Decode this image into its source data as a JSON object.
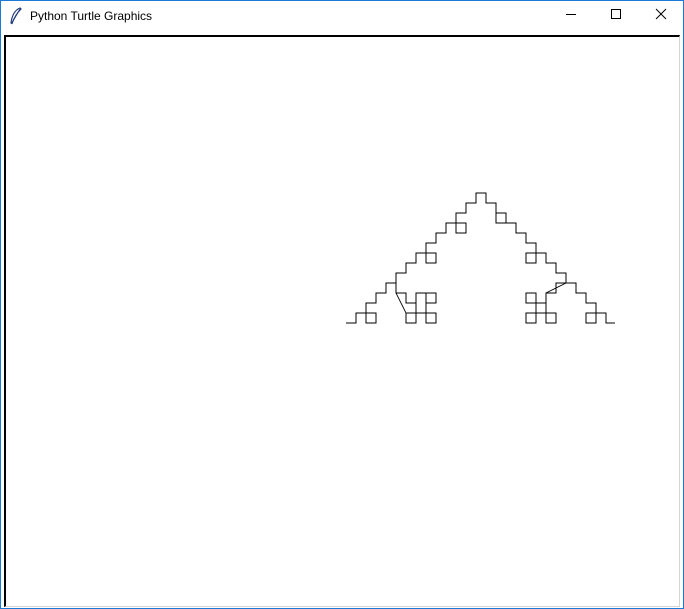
{
  "window": {
    "title": "Python Turtle Graphics",
    "icon": "feather-icon",
    "controls": [
      "minimize-icon",
      "maximize-icon",
      "close-icon"
    ]
  },
  "canvas": {
    "background": "#ffffff",
    "pen_color": "#000000",
    "drawing": "sierpinski-arrowhead-curve"
  }
}
